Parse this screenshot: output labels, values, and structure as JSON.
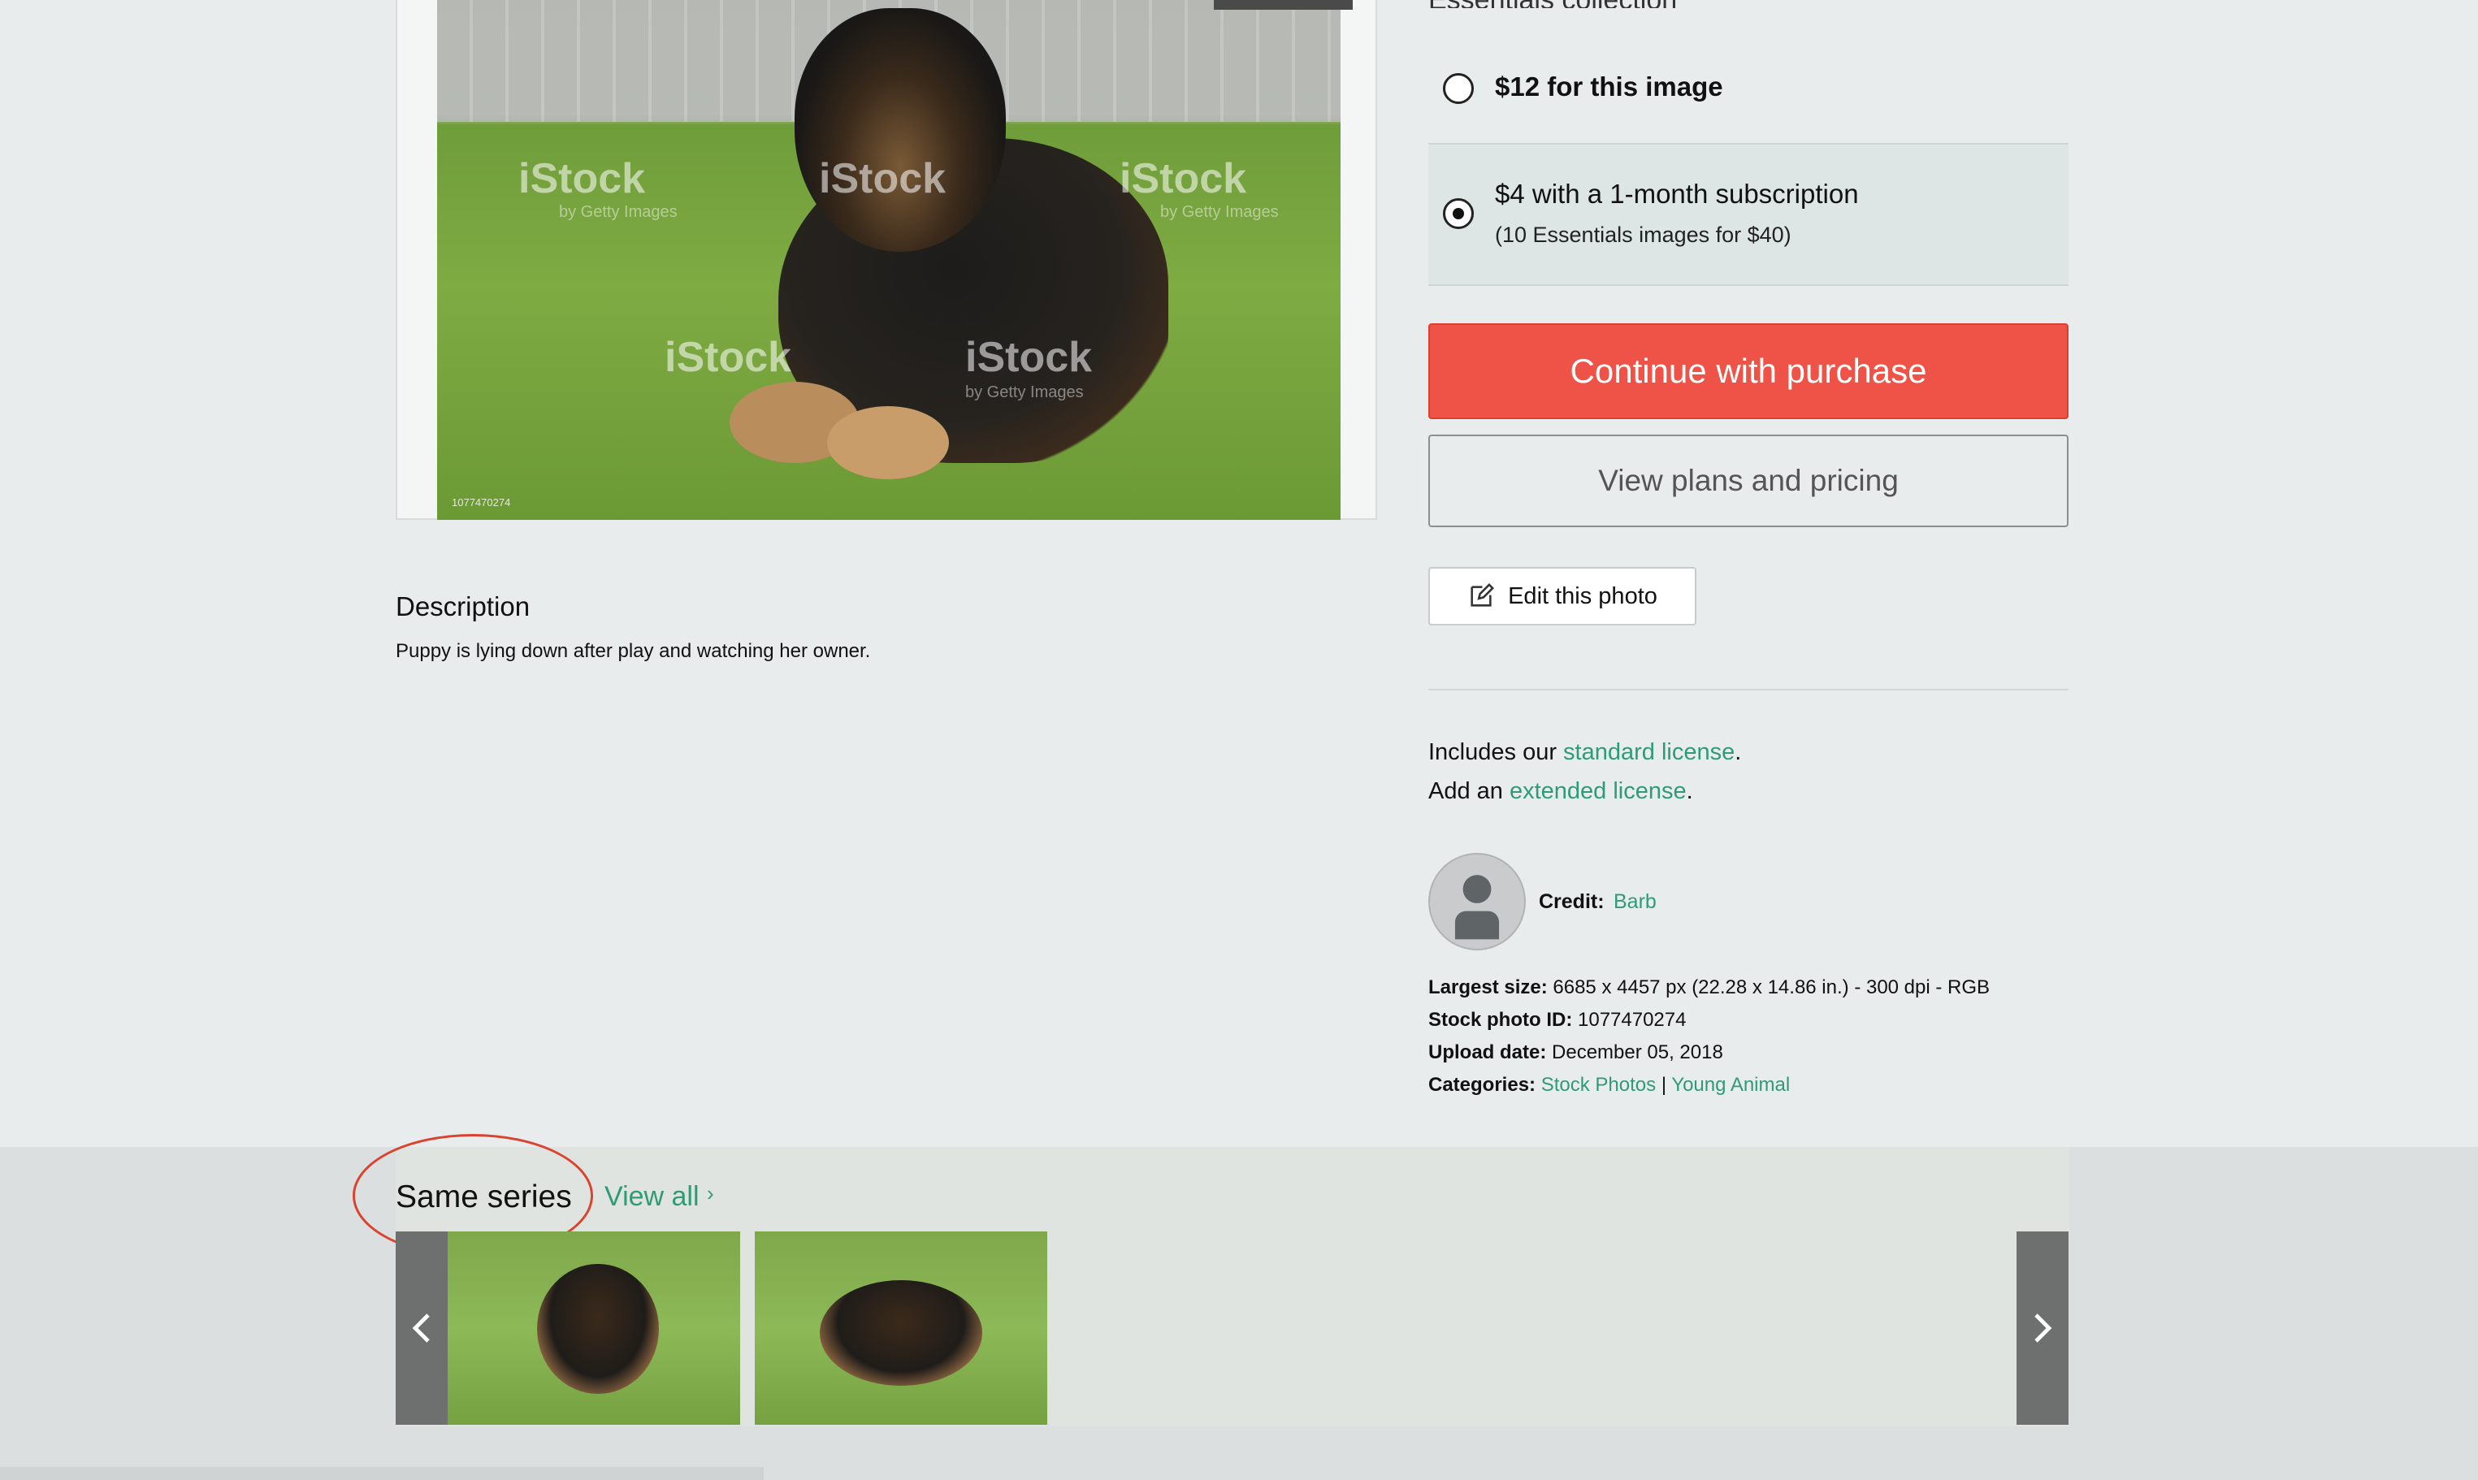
{
  "photo": {
    "watermark": "iStock",
    "watermark_sub": "by Getty Images",
    "id_overlay": "1077470274"
  },
  "pricing": {
    "partial_heading": "Essentials collection",
    "option1": {
      "label": "$12 for this image",
      "selected": false
    },
    "option2": {
      "label": "$4 with a 1-month subscription",
      "sublabel": "(10 Essentials images for $40)",
      "selected": true
    },
    "primary_button": "Continue with purchase",
    "secondary_button": "View plans and pricing",
    "edit_button": "Edit this photo"
  },
  "license": {
    "line1_prefix": "Includes our ",
    "line1_link": "standard license",
    "line1_suffix": ".",
    "line2_prefix": "Add an ",
    "line2_link": "extended license",
    "line2_suffix": "."
  },
  "credit": {
    "label": "Credit:",
    "name": "Barb"
  },
  "meta": {
    "largest_size_label": "Largest size:",
    "largest_size_value": "6685 x 4457 px (22.28 x 14.86 in.) - 300 dpi - RGB",
    "stock_id_label": "Stock photo ID:",
    "stock_id_value": "1077470274",
    "upload_label": "Upload date:",
    "upload_value": "December 05, 2018",
    "categories_label": "Categories:",
    "category1": "Stock Photos",
    "separator": "|",
    "category2": "Young Animal"
  },
  "description": {
    "title": "Description",
    "text": "Puppy is lying down after play and watching her owner."
  },
  "series": {
    "title": "Same series",
    "view_all": "View all",
    "view_all_chevron": "›"
  },
  "colors": {
    "accent": "#2f9b76",
    "primary_button": "#ef5348",
    "annotation": "#d9432f"
  }
}
